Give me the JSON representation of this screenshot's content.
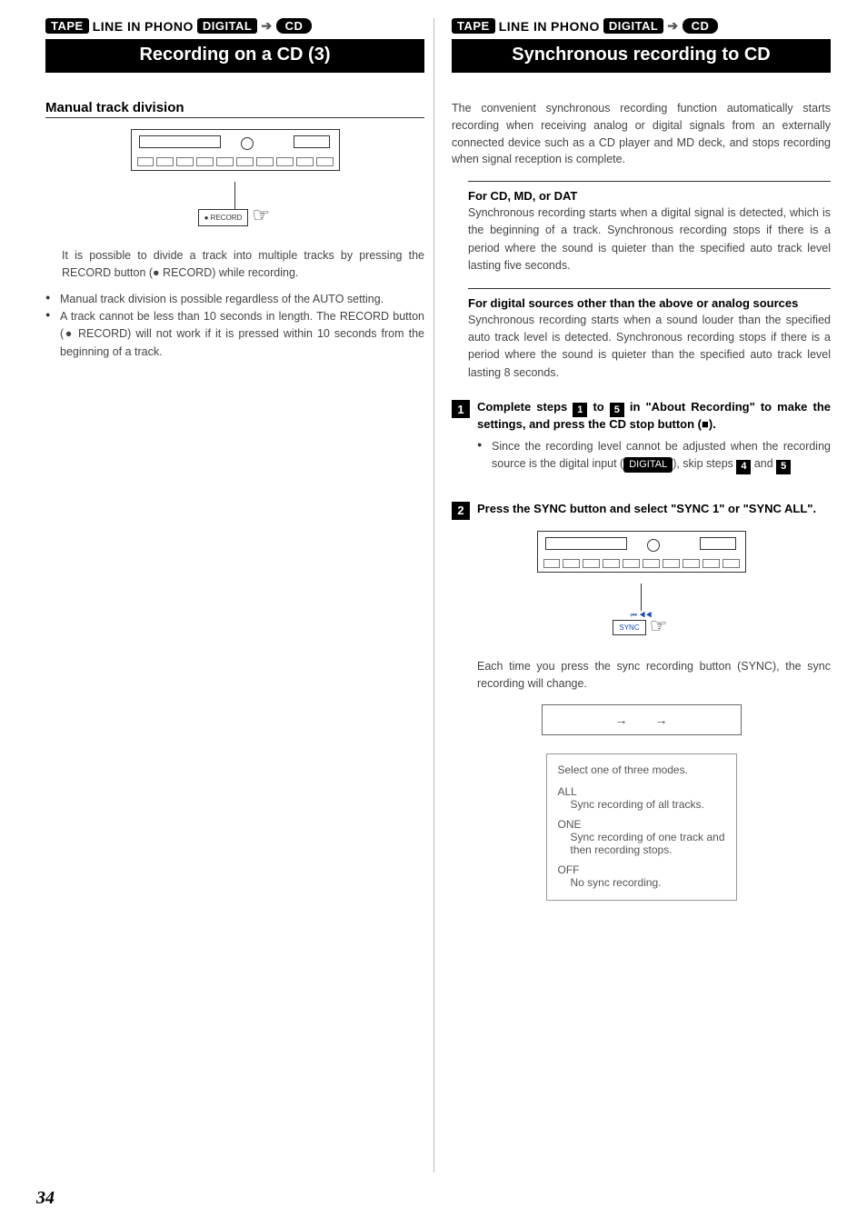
{
  "sourceStrip": {
    "tape": "TAPE",
    "lineIn": "LINE IN",
    "phono": "PHONO",
    "digital": "DIGITAL",
    "cd": "CD"
  },
  "left": {
    "title": "Recording on a CD (3)",
    "section": "Manual track division",
    "recordLabel": "● RECORD",
    "para1": "It is possible to divide a track into multiple tracks by pressing the RECORD button (● RECORD) while recording.",
    "bullet1": "Manual track division is possible regardless of the AUTO setting.",
    "bullet2": "A track cannot be less than 10 seconds in length. The RECORD button (● RECORD) will not work if it is pressed within 10 seconds from the beginning of a track."
  },
  "right": {
    "title": "Synchronous recording to CD",
    "intro": "The convenient synchronous recording function automatically starts recording when receiving analog or digital signals from an externally connected device such as a CD player and MD deck, and stops recording when signal reception is complete.",
    "sub1h": "For CD, MD, or DAT",
    "sub1": "Synchronous recording starts when a digital signal is detected, which is the beginning of a track. Synchronous recording stops if there is a period where the sound is quieter than the specified auto track level lasting five seconds.",
    "sub2h": "For digital sources other than the above or analog sources",
    "sub2": "Synchronous recording starts when a sound louder than the specified auto track level is detected. Synchronous recording stops if there is a period where the sound is quieter than the specified auto track level lasting 8 seconds.",
    "step1": {
      "pre": "Complete steps ",
      "mid": " to ",
      "post": " in \"About Recording\" to make the settings, and press the CD stop button (■).",
      "bullet_a": "Since the recording level cannot be adjusted when the recording source is the digital input (",
      "bullet_b": "), skip steps ",
      "bullet_c": " and "
    },
    "step2": "Press the SYNC button and select \"SYNC 1\" or \"SYNC ALL\".",
    "syncLabelTop": "⏮ ◀◀",
    "syncLabel": "SYNC",
    "afterFig": "Each time you press the sync recording button (SYNC), the sync recording will change.",
    "modeBox": {
      "head": "Select one of three modes.",
      "allT": "ALL",
      "allD": "Sync recording of all tracks.",
      "oneT": "ONE",
      "oneD": "Sync recording of one track and then recording stops.",
      "offT": "OFF",
      "offD": "No sync recording."
    }
  },
  "nums": {
    "n1": "1",
    "n2": "2",
    "n4": "4",
    "n5": "5"
  },
  "pageNumber": "34"
}
